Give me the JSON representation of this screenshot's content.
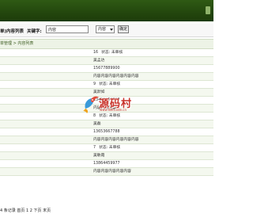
{
  "search": {
    "title": "单)内容列表",
    "keyword_label": "关键字:",
    "keyword_value": "内容",
    "select_value": "内容",
    "submit_label": "确定"
  },
  "breadcrumb": "单管理 > 内容列表",
  "rows": [
    {
      "text": "16",
      "status": "状态: 未审核",
      "alt": false
    },
    {
      "text": "吴孟达",
      "status": "",
      "alt": true
    },
    {
      "text": "15677889900",
      "status": "",
      "alt": false
    },
    {
      "text": "内容内容内容内容内容内容",
      "status": "",
      "alt": true
    },
    {
      "text": "9",
      "status": "状态: 未审核",
      "alt": false
    },
    {
      "text": "吴默如",
      "status": "",
      "alt": true
    },
    {
      "text": "13455667788",
      "status": "",
      "alt": false
    },
    {
      "text": "内容内容内容",
      "status": "",
      "alt": true
    },
    {
      "text": "8",
      "status": "状态: 未审核",
      "alt": false
    },
    {
      "text": "吴磊",
      "status": "",
      "alt": true
    },
    {
      "text": "13653667788",
      "status": "",
      "alt": false
    },
    {
      "text": "内容内容内容内容内容内容",
      "status": "",
      "alt": true
    },
    {
      "text": "7",
      "status": "状态: 未审核",
      "alt": false
    },
    {
      "text": "吴敏霞",
      "status": "",
      "alt": true
    },
    {
      "text": "13864459977",
      "status": "",
      "alt": false
    },
    {
      "text": "内容内容内容内容内容",
      "status": "",
      "alt": true
    }
  ],
  "watermark": {
    "text": "源码村",
    "url": "www.NetCode.cn"
  },
  "pager": "4 条记录 首页 1 2 下页 末页"
}
